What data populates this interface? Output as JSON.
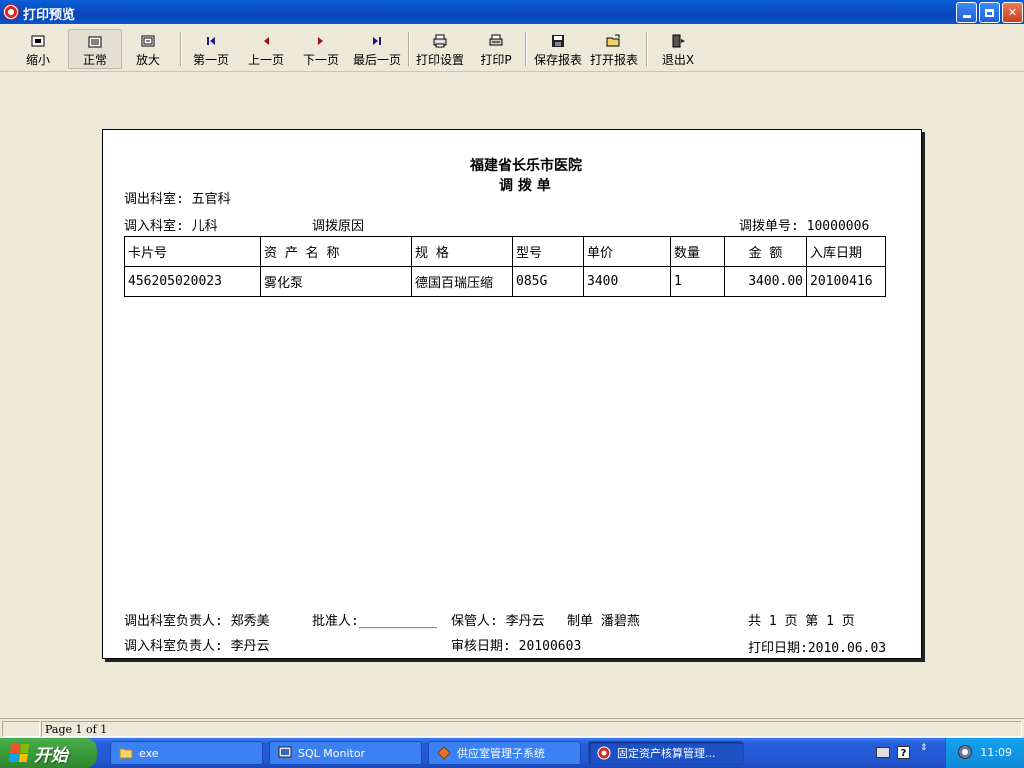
{
  "window": {
    "title": "打印预览"
  },
  "toolbar": {
    "zoom_out": "缩小",
    "normal": "正常",
    "zoom_in": "放大",
    "first_page": "第一页",
    "prev_page": "上一页",
    "next_page": "下一页",
    "last_page": "最后一页",
    "print_setup": "打印设置",
    "print": "打印P",
    "save_report": "保存报表",
    "open_report": "打开报表",
    "exit": "退出X"
  },
  "report": {
    "hospital": "福建省长乐市医院",
    "doc_title": "调 拨 单",
    "out_dept": "调出科室: 五官科",
    "in_dept": "调入科室: 儿科",
    "reason_label": "调拨原因",
    "order_no": "调拨单号: 10000006",
    "table": {
      "headers": [
        "卡片号",
        "资 产 名 称",
        "规  格",
        "型号",
        "单价",
        "数量",
        "金 额",
        "入库日期"
      ],
      "rows": [
        [
          "456205020023",
          "雾化泵",
          "德国百瑞压缩",
          "085G",
          "3400",
          "1",
          "3400.00",
          "20100416"
        ]
      ]
    },
    "out_manager": "调出科室负责人: 郑秀美",
    "approver": "批准人:__________",
    "keeper": "保管人: 李丹云",
    "maker": "制单   潘碧燕",
    "page_info": "共 1  页 第 1  页",
    "in_manager": "调入科室负责人: 李丹云",
    "audit_date": "审核日期: 20100603",
    "print_date": "打印日期:2010.06.03"
  },
  "statusbar": {
    "page": "Page 1 of 1"
  },
  "taskbar": {
    "start": "开始",
    "tasks": [
      "exe",
      "SQL Monitor",
      "供应室管理子系统",
      "固定资产核算管理..."
    ],
    "clock": "11:09"
  },
  "colors": {
    "titlebar": "#0a4fc4",
    "taskbar": "#245edb",
    "start": "#3a9a3a",
    "face": "#ece9d8"
  }
}
